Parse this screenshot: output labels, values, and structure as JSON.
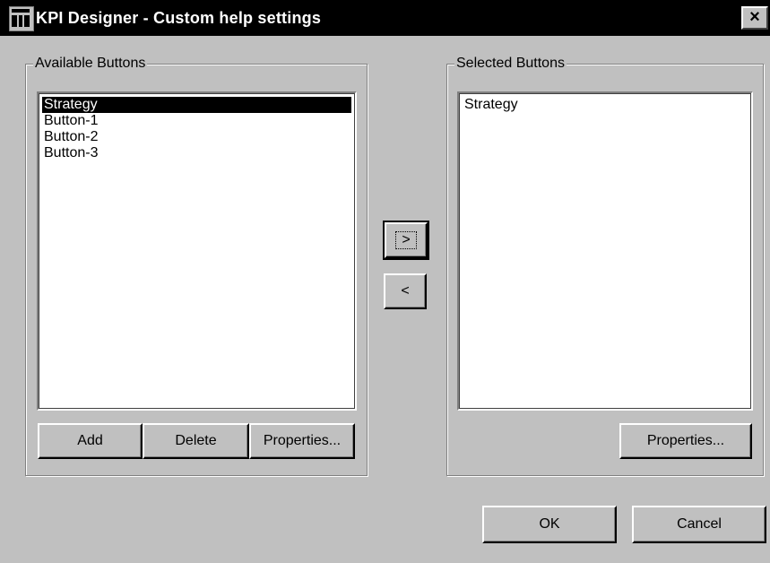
{
  "window": {
    "title": "KPI Designer - Custom help settings",
    "close_glyph": "×",
    "icon": "app-window-icon"
  },
  "available": {
    "label": "Available Buttons",
    "items": [
      "Strategy",
      "Button-1",
      "Button-2",
      "Button-3"
    ],
    "selected_index": 0,
    "add_label": "Add",
    "delete_label": "Delete",
    "properties_label": "Properties..."
  },
  "transfer": {
    "add_arrow": ">",
    "remove_arrow": "<"
  },
  "selected": {
    "label": "Selected Buttons",
    "items": [
      "Strategy"
    ],
    "properties_label": "Properties..."
  },
  "footer": {
    "ok_label": "OK",
    "cancel_label": "Cancel"
  }
}
